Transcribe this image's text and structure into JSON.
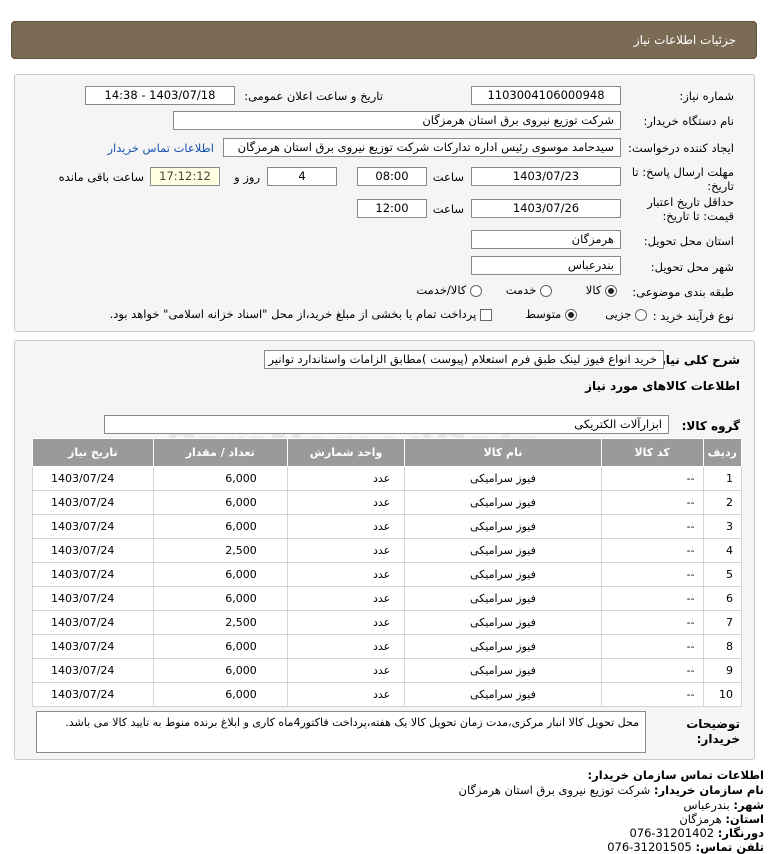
{
  "header": {
    "title": "جزئیات اطلاعات نیاز"
  },
  "info": {
    "need_number_label": "شماره نیاز:",
    "need_number": "1103004106000948",
    "announce_label": "تاریخ و ساعت اعلان عمومی:",
    "announce_value": "1403/07/18 - 14:38",
    "buyer_org_label": "نام دستگاه خریدار:",
    "buyer_org": "شرکت توزیع نیروی برق استان هرمزگان",
    "creator_label": "ایجاد کننده درخواست:",
    "creator": "سیدحامد موسوی رئیس اداره تدارکات شرکت توزیع نیروی برق استان هرمزگان",
    "contact_link": "اطلاعات تماس خریدار",
    "deadline_label_1": "مهلت ارسال پاسخ: تا",
    "deadline_label_2": "تاریخ:",
    "deadline_date": "1403/07/23",
    "time_label": "ساعت",
    "deadline_time": "08:00",
    "days_value": "4",
    "days_label": "روز و",
    "remaining_time": "17:12:12",
    "remaining_label": "ساعت باقی مانده",
    "validity_label_1": "حداقل تاریخ اعتبار",
    "validity_label_2": "قیمت: تا تاریخ:",
    "validity_date": "1403/07/26",
    "validity_time": "12:00",
    "province_label": "استان محل تحویل:",
    "province": "هرمزگان",
    "city_label": "شهر محل تحویل:",
    "city": "بندرعباس",
    "category_label": "طبقه بندی موضوعی:",
    "category_options": [
      "کالا",
      "خدمت",
      "کالا/خدمت"
    ],
    "category_selected": "کالا",
    "process_label": "نوع فرآیند خرید :",
    "process_options": [
      "جزیی",
      "متوسط"
    ],
    "process_selected": "متوسط",
    "payment_note": "پرداخت تمام یا بخشی از مبلغ خرید،از محل \"اسناد خزانه اسلامی\" خواهد بود."
  },
  "summary": {
    "desc_label": "شرح کلی نیاز:",
    "desc": "خرید انواع فیوز لینک طبق فرم استعلام (پیوست )مطابق الزامات واستاندارد توانیر",
    "goods_title": "اطلاعات کالاهای مورد نیاز",
    "group_label": "گروه کالا:",
    "group": "ابزارآلات الکتریکی",
    "columns": [
      "ردیف",
      "کد کالا",
      "نام کالا",
      "واحد شمارش",
      "تعداد / مقدار",
      "تاریخ نیاز"
    ],
    "rows": [
      {
        "radif": "1",
        "code": "--",
        "name": "فیوز سرامیکی",
        "unit": "عدد",
        "qty": "6,000",
        "date": "1403/07/24"
      },
      {
        "radif": "2",
        "code": "--",
        "name": "فیوز سرامیکی",
        "unit": "عدد",
        "qty": "6,000",
        "date": "1403/07/24"
      },
      {
        "radif": "3",
        "code": "--",
        "name": "فیوز سرامیکی",
        "unit": "عدد",
        "qty": "6,000",
        "date": "1403/07/24"
      },
      {
        "radif": "4",
        "code": "--",
        "name": "فیوز سرامیکی",
        "unit": "عدد",
        "qty": "2,500",
        "date": "1403/07/24"
      },
      {
        "radif": "5",
        "code": "--",
        "name": "فیوز سرامیکی",
        "unit": "عدد",
        "qty": "6,000",
        "date": "1403/07/24"
      },
      {
        "radif": "6",
        "code": "--",
        "name": "فیوز سرامیکی",
        "unit": "عدد",
        "qty": "6,000",
        "date": "1403/07/24"
      },
      {
        "radif": "7",
        "code": "--",
        "name": "فیوز سرامیکی",
        "unit": "عدد",
        "qty": "2,500",
        "date": "1403/07/24"
      },
      {
        "radif": "8",
        "code": "--",
        "name": "فیوز سرامیکی",
        "unit": "عدد",
        "qty": "6,000",
        "date": "1403/07/24"
      },
      {
        "radif": "9",
        "code": "--",
        "name": "فیوز سرامیکی",
        "unit": "عدد",
        "qty": "6,000",
        "date": "1403/07/24"
      },
      {
        "radif": "10",
        "code": "--",
        "name": "فیوز سرامیکی",
        "unit": "عدد",
        "qty": "6,000",
        "date": "1403/07/24"
      }
    ],
    "notes_label_1": "توضیحات",
    "notes_label_2": "خریدار:",
    "notes": "محل تحویل کالا انبار مرکزی،مدت زمان تحویل کالا یک هفته،پرداخت فاکتور4ماه کاری و ابلاغ برنده منوط به تایید کالا می باشد."
  },
  "contact": {
    "title": "اطلاعات تماس سازمان خریدار:",
    "org_label": "نام سازمان خریدار:",
    "org": "شرکت توزیع نیروی برق استان هرمزگان",
    "city_label": "شهر:",
    "city": "بندرعباس",
    "province_label": "استان:",
    "province": "هرمزگان",
    "phone_label": "دورنگار:",
    "phone": "076-31201402",
    "phone2_label": "تلفن تماس:",
    "phone2": "076-31201505"
  },
  "watermark": {
    "line1": "ParsNamadData",
    "line2": "مرکز تجمیع اطلاعات پارس نماد داده ها",
    "line3": "پایگاه اطلاع رسانی مناقصه و مزایده",
    "line4": "۰۲۱-۸۸۳۴۹۶۷۰"
  }
}
